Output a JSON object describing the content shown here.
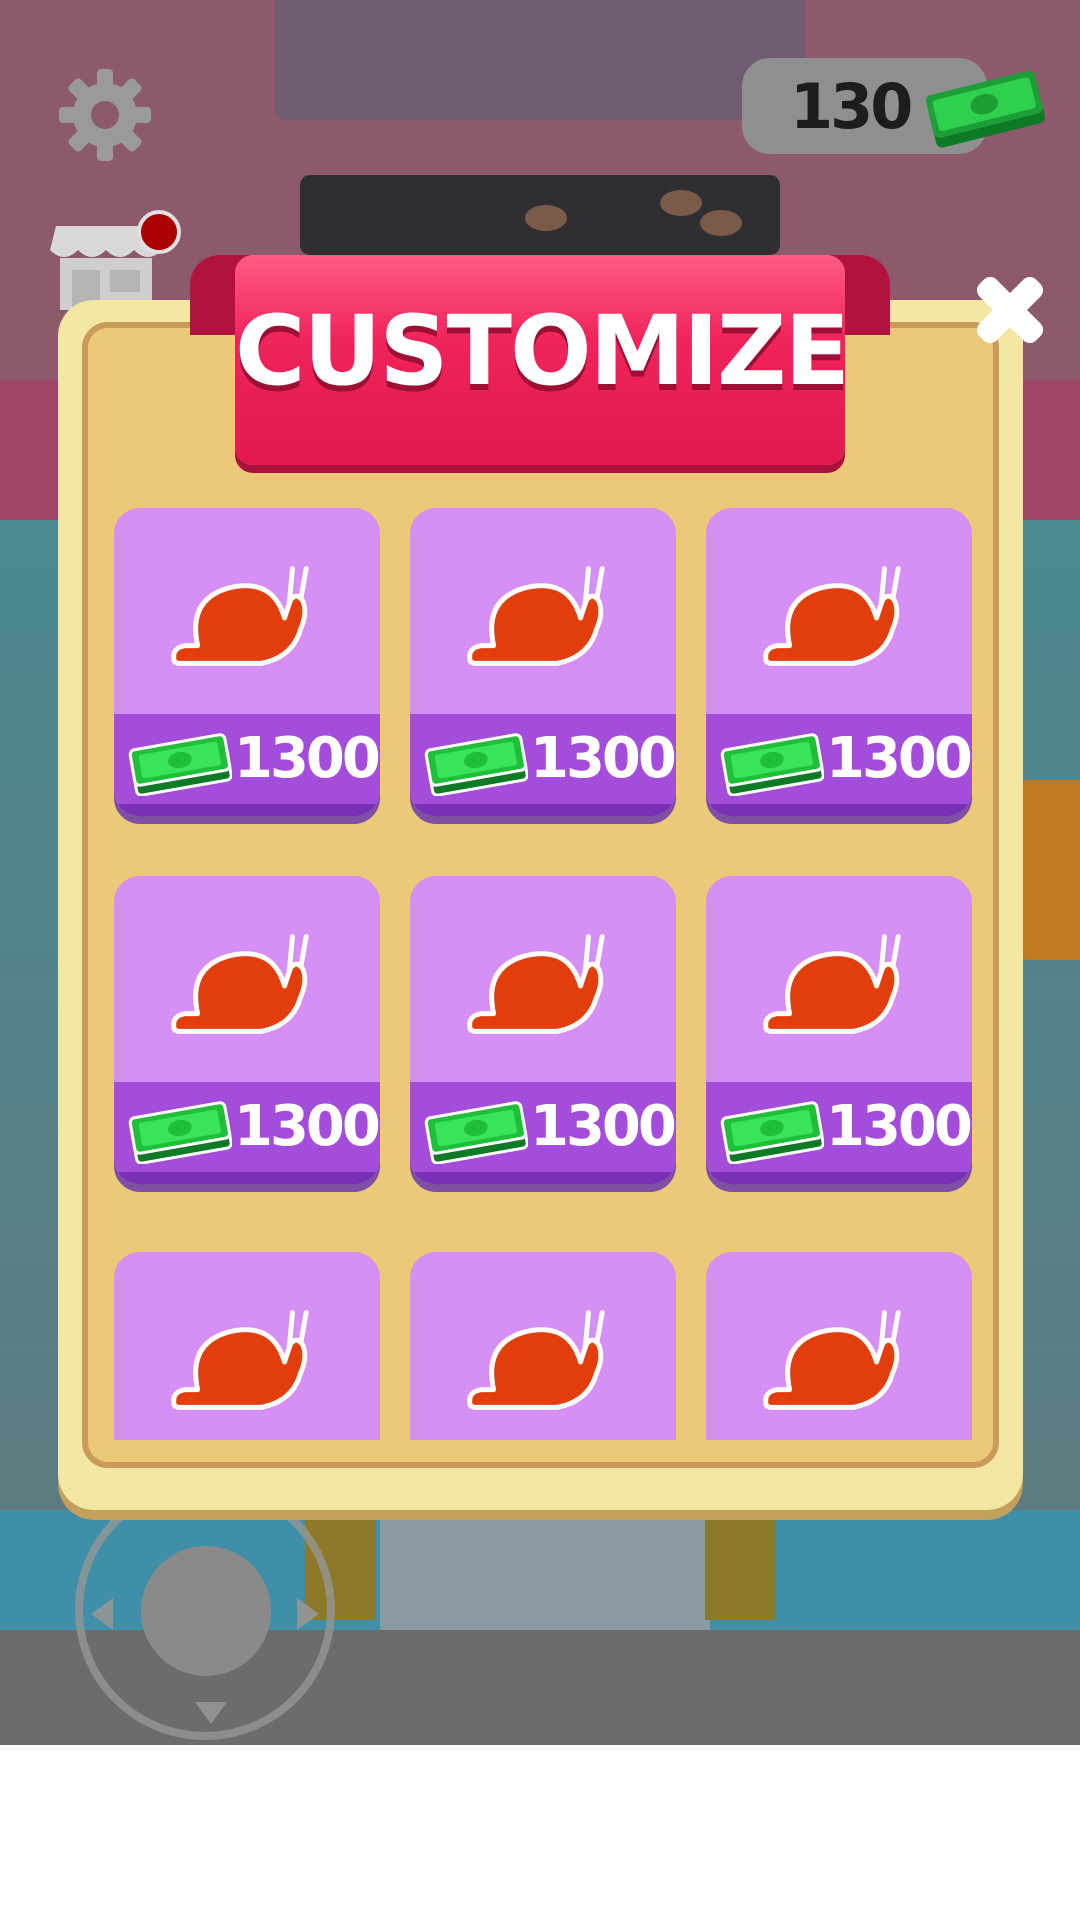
{
  "hud": {
    "money": "130",
    "icons": {
      "settings": "gear-icon",
      "shop": "shop-icon",
      "money": "cash-icon",
      "joystick": "joystick"
    }
  },
  "customize": {
    "title": "CUSTOMIZE",
    "close_icon": "close-icon",
    "items": [
      {
        "icon": "snail-icon",
        "price": "1300"
      },
      {
        "icon": "snail-icon",
        "price": "1300"
      },
      {
        "icon": "snail-icon",
        "price": "1300"
      },
      {
        "icon": "snail-icon",
        "price": "1300"
      },
      {
        "icon": "snail-icon",
        "price": "1300"
      },
      {
        "icon": "snail-icon",
        "price": "1300"
      },
      {
        "icon": "snail-icon",
        "price": null
      },
      {
        "icon": "snail-icon",
        "price": null
      },
      {
        "icon": "snail-icon",
        "price": null
      }
    ]
  },
  "colors": {
    "banner": "#e31850",
    "panel": "#ecc978",
    "card": "#d68ff5",
    "price_bar": "#a44ddb",
    "snail": "#e13e0b",
    "cash": "#1fbf3a"
  }
}
